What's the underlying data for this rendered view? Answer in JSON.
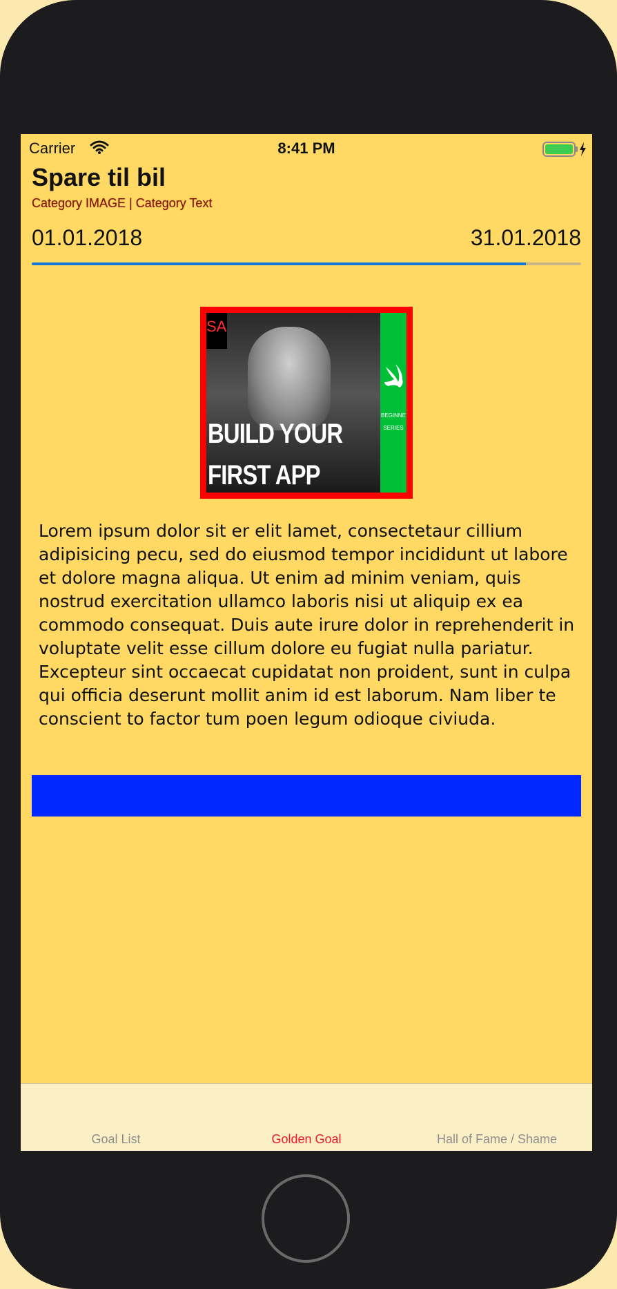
{
  "status_bar": {
    "carrier": "Carrier",
    "time": "8:41 PM",
    "wifi_icon": "wifi-icon",
    "battery_icon": "battery-charging-icon"
  },
  "goal": {
    "title": "Spare til bil",
    "category": "Category IMAGE | Category Text",
    "start_date": "01.01.2018",
    "end_date": "31.01.2018",
    "progress": 0.9
  },
  "thumbnail": {
    "badge": "SA",
    "headline_line1": "BUILD YOUR",
    "headline_line2": "FIRST APP",
    "side_line1": "BEGINNE",
    "side_line2": "SERIES"
  },
  "description": "Lorem ipsum dolor sit er elit lamet, consectetaur cillium adipisicing pecu, sed do eiusmod tempor incididunt ut labore et dolore magna aliqua. Ut enim ad minim veniam, quis nostrud exercitation ullamco laboris nisi ut aliquip ex ea commodo consequat. Duis aute irure dolor in reprehenderit in voluptate velit esse cillum dolore eu fugiat nulla pariatur. Excepteur sint occaecat cupidatat non proident, sunt in culpa qui officia deserunt mollit anim id est laborum. Nam liber te conscient to factor tum poen legum odioque civiuda.",
  "tabs": [
    {
      "label": "Goal List"
    },
    {
      "label": "Golden Goal"
    },
    {
      "label": "Hall of Fame / Shame"
    }
  ],
  "colors": {
    "background": "#ffd963",
    "progress": "#1479d8",
    "selected_tab": "#f0182c",
    "blue_bar": "#0028ff"
  }
}
